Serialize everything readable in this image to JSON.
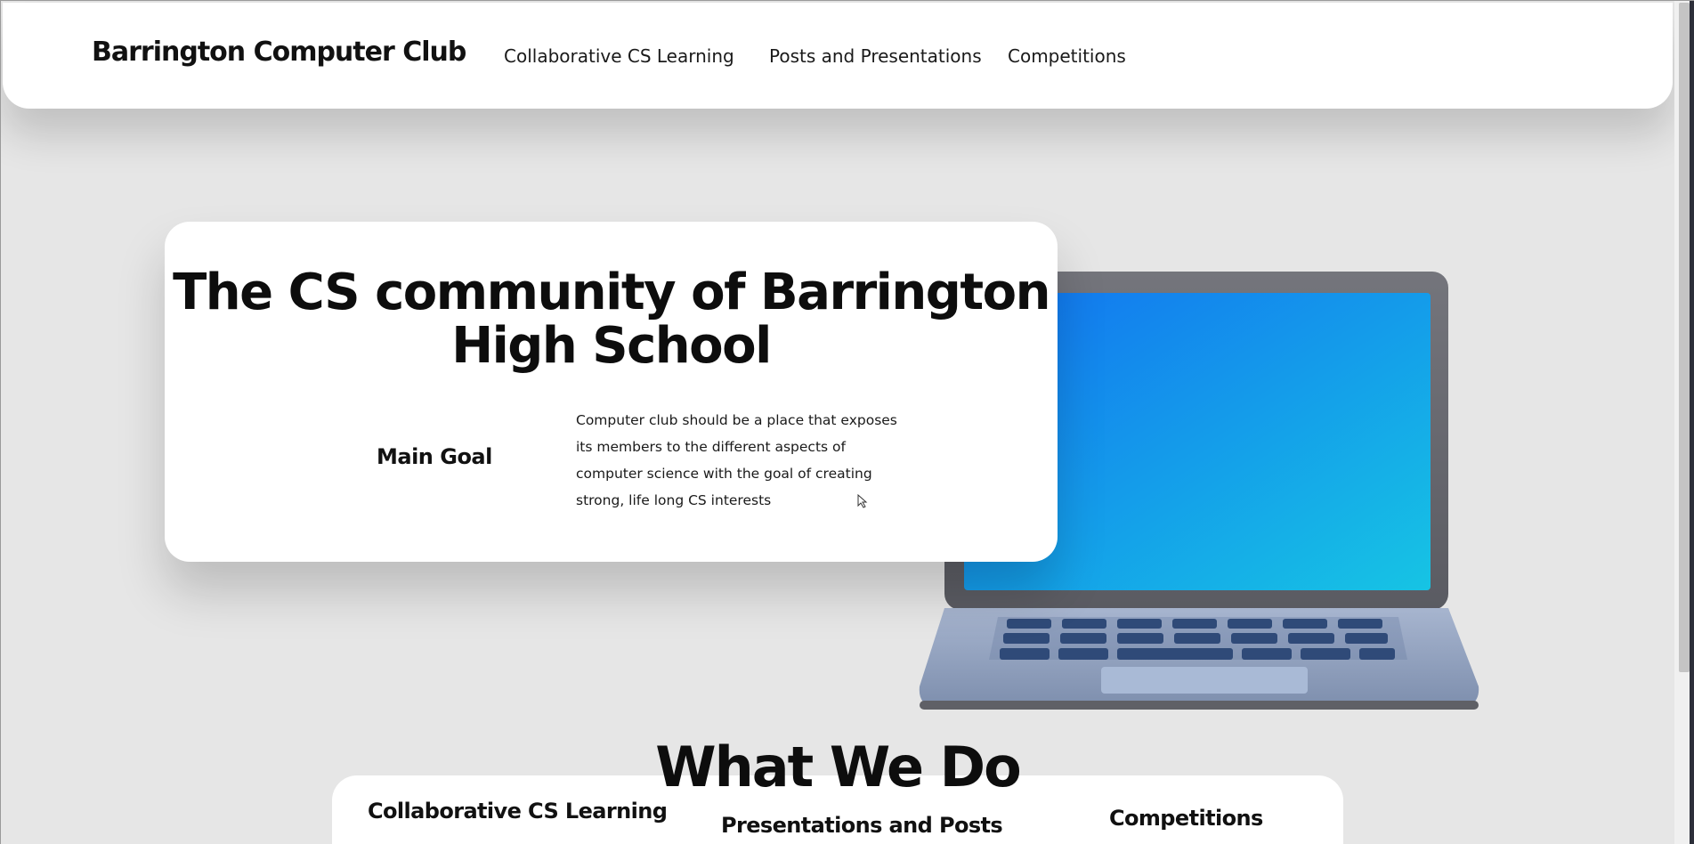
{
  "header": {
    "brand": "Barrington Computer Club",
    "nav": [
      {
        "label": "Collaborative CS Learning"
      },
      {
        "label": "Posts and Presentations"
      },
      {
        "label": "Competitions"
      }
    ]
  },
  "hero": {
    "title": "The CS community of Barrington High School",
    "goal_label": "Main Goal",
    "goal_text": "Computer club should be a place that exposes its members to the different aspects of computer science with the goal of creating strong, life long CS interests",
    "image": "laptop-illustration"
  },
  "what_we_do": {
    "title": "What We Do",
    "features": [
      {
        "label": "Collaborative CS Learning"
      },
      {
        "label": "Presentations and Posts"
      },
      {
        "label": "Competitions"
      }
    ]
  },
  "colors": {
    "background": "#e6e6e6",
    "card": "#ffffff",
    "screen_start": "#1273f0",
    "screen_end": "#16c4e4",
    "laptop_body": "#8a9ab8"
  }
}
